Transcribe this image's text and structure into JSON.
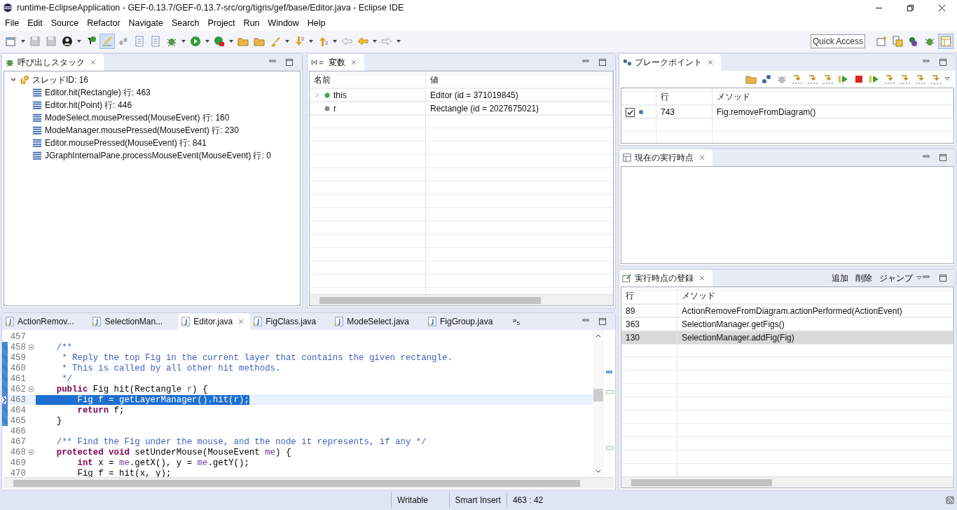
{
  "window": {
    "title": "runtime-EclipseApplication - GEF-0.13.7/GEF-0.13.7-src/org/tigris/gef/base/Editor.java - Eclipse IDE"
  },
  "menu": [
    "File",
    "Edit",
    "Source",
    "Refactor",
    "Navigate",
    "Search",
    "Project",
    "Run",
    "Window",
    "Help"
  ],
  "toolbar": {
    "quick_access": {
      "placeholder": "Quick Access"
    }
  },
  "call_stack": {
    "title": "呼び出しスタック",
    "thread": {
      "label": "スレッドID: 16",
      "expanded": true,
      "children": [
        {
          "label": "Editor.hit(Rectangle) 行: 463"
        },
        {
          "label": "Editor.hit(Point) 行: 446"
        },
        {
          "label": "ModeSelect.mousePressed(MouseEvent) 行: 160"
        },
        {
          "label": "ModeManager.mousePressed(MouseEvent) 行: 230"
        },
        {
          "label": "Editor.mousePressed(MouseEvent) 行: 841"
        },
        {
          "label": "JGraphInternalPane.processMouseEvent(MouseEvent) 行: 0"
        }
      ]
    }
  },
  "variables": {
    "title": "変数",
    "columns": [
      "名前",
      "値"
    ],
    "rows": [
      {
        "name": "this",
        "value": "Editor (id = 371019845)",
        "kind": "object",
        "expandable": true
      },
      {
        "name": "r",
        "value": "Rectangle (id = 2027675021)",
        "kind": "local",
        "expandable": false
      }
    ]
  },
  "breakpoints": {
    "title": "ブレークポイント",
    "columns": [
      "行",
      "メソッド"
    ],
    "rows": [
      {
        "checked": true,
        "line": "743",
        "method": "Fig.removeFromDiagram()"
      }
    ]
  },
  "current_point": {
    "title": "現在の実行時点"
  },
  "recorded_points": {
    "title": "実行時点の登録",
    "actions": [
      "追加",
      "削除",
      "ジャンプ"
    ],
    "columns": [
      "行",
      "メソッド"
    ],
    "rows": [
      {
        "line": "89",
        "method": "ActionRemoveFromDiagram.actionPerformed(ActionEvent)",
        "selected": false
      },
      {
        "line": "363",
        "method": "SelectionManager.getFigs()",
        "selected": false
      },
      {
        "line": "130",
        "method": "SelectionManager.addFig(Fig)",
        "selected": true
      }
    ]
  },
  "editor": {
    "tabs": [
      {
        "label": "ActionRemov...",
        "selected": false
      },
      {
        "label": "SelectionMan...",
        "selected": false
      },
      {
        "label": "Editor.java",
        "selected": true
      },
      {
        "label": "FigClass.java",
        "selected": false
      },
      {
        "label": "ModeSelect.java",
        "selected": false
      },
      {
        "label": "FigGroup.java",
        "selected": false
      }
    ],
    "overflow": {
      "symbol": "»",
      "count": "5"
    },
    "lines": [
      {
        "number": "457",
        "foldable": false,
        "in_range": false,
        "current": false
      },
      {
        "number": "458",
        "foldable": true,
        "in_range": true,
        "current": false,
        "segments": [
          {
            "kind": "comment",
            "text": "    /**"
          }
        ]
      },
      {
        "number": "459",
        "foldable": false,
        "in_range": true,
        "current": false,
        "segments": [
          {
            "kind": "comment",
            "text": "     * Reply the top Fig in the current layer that contains the given rectangle."
          }
        ]
      },
      {
        "number": "460",
        "foldable": false,
        "in_range": true,
        "current": false,
        "segments": [
          {
            "kind": "comment",
            "text": "     * This is called by all other hit methods."
          }
        ]
      },
      {
        "number": "461",
        "foldable": false,
        "in_range": true,
        "current": false,
        "segments": [
          {
            "kind": "comment",
            "text": "     */"
          }
        ]
      },
      {
        "number": "462",
        "foldable": true,
        "in_range": true,
        "current": false,
        "segments": [
          {
            "kind": "keyword",
            "text": "    public"
          },
          {
            "kind": "plain",
            "text": " Fig hit(Rectangle "
          },
          {
            "kind": "variable",
            "text": "r"
          },
          {
            "kind": "plain",
            "text": ") {"
          }
        ]
      },
      {
        "number": "463",
        "foldable": false,
        "in_range": true,
        "current": true,
        "segments": [
          {
            "kind": "plain",
            "text": "        Fig f = getLayerManager().hit("
          },
          {
            "kind": "variable",
            "text": "r"
          },
          {
            "kind": "plain",
            "text": ");"
          }
        ]
      },
      {
        "number": "464",
        "foldable": false,
        "in_range": true,
        "current": false,
        "segments": [
          {
            "kind": "keyword",
            "text": "        return"
          },
          {
            "kind": "plain",
            "text": " f;"
          }
        ]
      },
      {
        "number": "465",
        "foldable": false,
        "in_range": true,
        "current": false,
        "segments": [
          {
            "kind": "plain",
            "text": "    }"
          }
        ]
      },
      {
        "number": "466",
        "foldable": false,
        "in_range": false,
        "current": false
      },
      {
        "number": "467",
        "foldable": false,
        "in_range": false,
        "current": false,
        "segments": [
          {
            "kind": "comment",
            "text": "    /** Find the Fig under the mouse, and the node it represents, if any */"
          }
        ]
      },
      {
        "number": "468",
        "foldable": true,
        "in_range": false,
        "current": false,
        "segments": [
          {
            "kind": "keyword",
            "text": "    protected void"
          },
          {
            "kind": "plain",
            "text": " setUnderMouse(MouseEvent "
          },
          {
            "kind": "variable",
            "text": "me"
          },
          {
            "kind": "plain",
            "text": ") {"
          }
        ]
      },
      {
        "number": "469",
        "foldable": false,
        "in_range": false,
        "current": false,
        "segments": [
          {
            "kind": "keyword",
            "text": "        int"
          },
          {
            "kind": "plain",
            "text": " x = "
          },
          {
            "kind": "variable",
            "text": "me"
          },
          {
            "kind": "plain",
            "text": ".getX(), y = "
          },
          {
            "kind": "variable",
            "text": "me"
          },
          {
            "kind": "plain",
            "text": ".getY();"
          }
        ]
      },
      {
        "number": "470",
        "foldable": false,
        "in_range": false,
        "current": false,
        "segments": [
          {
            "kind": "plain",
            "text": "        Fig f = hit(x, y);"
          }
        ]
      }
    ]
  },
  "status_bar": [
    "Writable",
    "Smart Insert",
    "463 : 42"
  ]
}
